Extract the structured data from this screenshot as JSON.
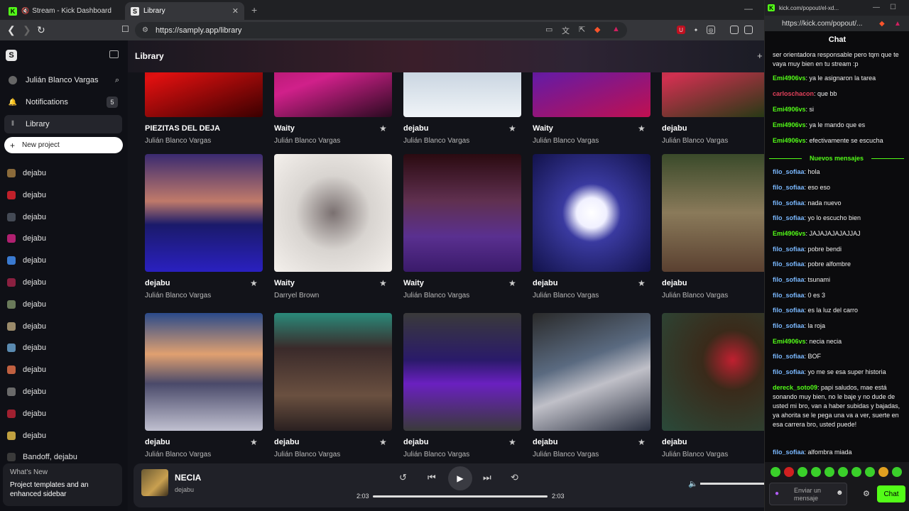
{
  "browser": {
    "tabs": [
      {
        "label": "Stream - Kick Dashboard"
      },
      {
        "label": "Library"
      }
    ],
    "url": "https://samply.app/library"
  },
  "sidebar": {
    "user": "Julián Blanco Vargas",
    "notifications_label": "Notifications",
    "notifications_count": "5",
    "library_label": "Library",
    "new_project_label": "New project",
    "projects": [
      {
        "label": "dejabu",
        "color": "#8a6a3a"
      },
      {
        "label": "dejabu",
        "color": "#c0202a"
      },
      {
        "label": "dejabu",
        "color": "#444a55"
      },
      {
        "label": "dejabu",
        "color": "#b02070"
      },
      {
        "label": "dejabu",
        "color": "#3a7ad0"
      },
      {
        "label": "dejabu",
        "color": "#8a2040"
      },
      {
        "label": "dejabu",
        "color": "#6a7a5a"
      },
      {
        "label": "dejabu",
        "color": "#9a8a6a"
      },
      {
        "label": "dejabu",
        "color": "#5a8ab0"
      },
      {
        "label": "dejabu",
        "color": "#c06040"
      },
      {
        "label": "dejabu",
        "color": "#6a6a6a"
      },
      {
        "label": "dejabu",
        "color": "#a02030"
      },
      {
        "label": "dejabu",
        "color": "#c0a040"
      },
      {
        "label": "Bandoff, dejabu",
        "color": "#3a3a3a"
      }
    ],
    "whats_new": {
      "title": "What's New",
      "body": "Project templates and an enhanced sidebar"
    }
  },
  "library": {
    "title": "Library",
    "rows": [
      [
        {
          "title": "PIEZITAS DEL DEJA",
          "artist": "Julián Blanco Vargas",
          "star": false,
          "bg": "linear-gradient(160deg,#5a0000,#e01010 50%,#3a0000)"
        },
        {
          "title": "Waity",
          "artist": "Julián Blanco Vargas",
          "star": true,
          "bg": "linear-gradient(160deg,#7a0a40,#d0208a 60%,#2a0a20)"
        },
        {
          "title": "dejabu",
          "artist": "Julián Blanco Vargas",
          "star": true,
          "bg": "linear-gradient(180deg,#6a7a8a,#c8d4e0 60%,#f0f4f8)"
        },
        {
          "title": "Waity",
          "artist": "Julián Blanco Vargas",
          "star": true,
          "bg": "linear-gradient(160deg,#1a0a40,#6a1aa0 50%,#c01050)"
        },
        {
          "title": "dejabu",
          "artist": "Julián Blanco Vargas",
          "star": false,
          "bg": "linear-gradient(160deg,#2a4a1a,#d03050 50%,#1a3a10)"
        }
      ],
      [
        {
          "title": "dejabu",
          "artist": "Julián Blanco Vargas",
          "star": true,
          "bg": "linear-gradient(180deg,#3a2a70 0%,#c07a6a 40%,#1a1a6a 60%,#2a20c0 100%)"
        },
        {
          "title": "Waity",
          "artist": "Darryel Brown",
          "star": true,
          "bg": "radial-gradient(circle at 50% 50%,#7a7070,#d8d4d0 45%,#f4f0ec 100%)"
        },
        {
          "title": "Waity",
          "artist": "Julián Blanco Vargas",
          "star": true,
          "bg": "linear-gradient(180deg,#2a0a10 0%,#603050 40%,#5a3090 70%,#3a1a6a 100%)"
        },
        {
          "title": "dejabu",
          "artist": "Julián Blanco Vargas",
          "star": true,
          "bg": "radial-gradient(ellipse at 50% 50%,#ffffff 0%,#f0f0ff 18%,#3a3aa0 35%,#12124a 100%)"
        },
        {
          "title": "dejabu",
          "artist": "Julián Blanco Vargas",
          "star": false,
          "bg": "linear-gradient(180deg,#3a4a2a 0%,#8a7a5a 50%,#5a4030 100%)"
        }
      ],
      [
        {
          "title": "dejabu",
          "artist": "Julián Blanco Vargas",
          "star": true,
          "bg": "linear-gradient(180deg,#2a4a8a 0%,#e0a070 35%,#4a4a6a 60%,#c0c0d0 100%)"
        },
        {
          "title": "dejabu",
          "artist": "Julián Blanco Vargas",
          "star": true,
          "bg": "linear-gradient(180deg,#2a8a7a 0%,#3a2a2a 30%,#6a5040 70%,#2a2020 100%)"
        },
        {
          "title": "dejabu",
          "artist": "Julián Blanco Vargas",
          "star": true,
          "bg": "linear-gradient(180deg,#3a3a3a 0%,#2a1a6a 40%,#6a20c0 60%,#3a3a3a 100%)"
        },
        {
          "title": "dejabu",
          "artist": "Julián Blanco Vargas",
          "star": true,
          "bg": "linear-gradient(160deg,#2a2a2a 0%,#5a6a80 40%,#c0c0c8 60%,#2a3040 100%)"
        },
        {
          "title": "dejabu",
          "artist": "Julián Blanco Vargas",
          "star": false,
          "bg": "radial-gradient(circle at 60% 40%,#c02030 0%,#3a2a1a 30%,#2a4a3a 100%)"
        }
      ]
    ]
  },
  "player": {
    "title": "NECIA",
    "artist": "dejabu",
    "time_current": "2:03",
    "time_total": "2:03",
    "progress": 1.0,
    "volume": 1.0
  },
  "popout": {
    "tab_label": "kick.com/popout/el-xd...",
    "url": "https://kick.com/popout/...",
    "chat_title": "Chat",
    "new_messages_label": "Nuevos mensajes",
    "input_placeholder": "Enviar un mensaje",
    "chat_button": "Chat",
    "accent": "#53fc18",
    "messages_before": [
      {
        "user": "",
        "text": "ser orientadora responsable pero tqm que te vaya muy bien en tu stream :p",
        "color": "#ffffff"
      },
      {
        "user": "Emi4906vs",
        "text": ": ya le asignaron la tarea",
        "color": "#53fc18"
      },
      {
        "user": "carloschacon",
        "text": ": que bb",
        "color": "#e0405a"
      },
      {
        "user": "Emi4906vs",
        "text": ": si",
        "color": "#53fc18"
      },
      {
        "user": "Emi4906vs",
        "text": ": ya le mando que es",
        "color": "#53fc18"
      },
      {
        "user": "Emi4906vs",
        "text": ": efectivamente se escucha",
        "color": "#53fc18"
      }
    ],
    "messages_after": [
      {
        "user": "filo_sofiaa",
        "text": ": hola",
        "color": "#7ab8ff"
      },
      {
        "user": "filo_sofiaa",
        "text": ": eso eso",
        "color": "#7ab8ff"
      },
      {
        "user": "filo_sofiaa",
        "text": ": nada nuevo",
        "color": "#7ab8ff"
      },
      {
        "user": "filo_sofiaa",
        "text": ": yo lo escucho bien",
        "color": "#7ab8ff"
      },
      {
        "user": "Emi4906vs",
        "text": ": JAJAJAJAJAJJAJ",
        "color": "#53fc18"
      },
      {
        "user": "filo_sofiaa",
        "text": ": pobre bendi",
        "color": "#7ab8ff"
      },
      {
        "user": "filo_sofiaa",
        "text": ": pobre alfombre",
        "color": "#7ab8ff"
      },
      {
        "user": "filo_sofiaa",
        "text": ": tsunami",
        "color": "#7ab8ff"
      },
      {
        "user": "filo_sofiaa",
        "text": ": 0 es 3",
        "color": "#7ab8ff"
      },
      {
        "user": "filo_sofiaa",
        "text": ": es la luz del carro",
        "color": "#7ab8ff"
      },
      {
        "user": "filo_sofiaa",
        "text": ": la roja",
        "color": "#7ab8ff"
      },
      {
        "user": "Emi4906vs",
        "text": ": necia necia",
        "color": "#53fc18"
      },
      {
        "user": "filo_sofiaa",
        "text": ": BOF",
        "color": "#7ab8ff"
      },
      {
        "user": "filo_sofiaa",
        "text": ": yo me se esa super historia",
        "color": "#7ab8ff"
      },
      {
        "user": "dereck_soto09",
        "text": ": papi saludos, mae está sonando muy bien, no le baje y no dude de usted mi bro, van a haber subidas y bajadas, ya ahorita se le pega una va a ver, suerte en esa carrera bro, usted puede!",
        "color": "#53fc18"
      },
      {
        "user": "filo_sofiaa",
        "text": ": alfombra miada",
        "color": "#7ab8ff"
      }
    ]
  }
}
